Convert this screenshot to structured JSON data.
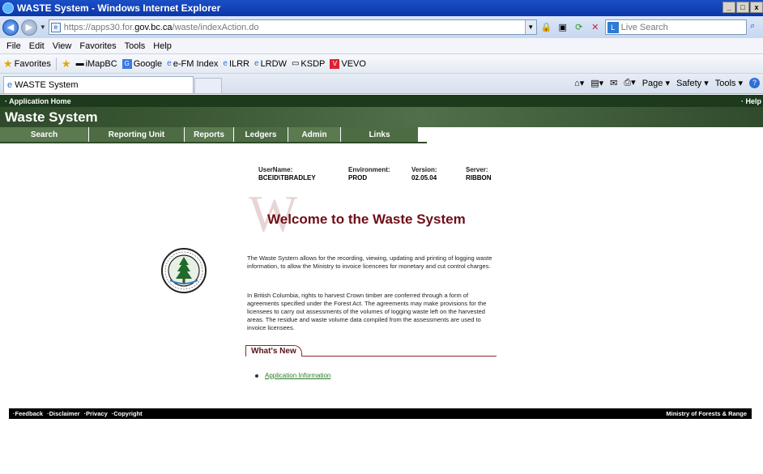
{
  "window": {
    "title": "WASTE System - Windows Internet Explorer",
    "controls": [
      "_",
      "□",
      "x"
    ]
  },
  "address": {
    "url_prefix": "https://apps30.for.",
    "url_domain": "gov.bc.ca",
    "url_path": "/waste/indexAction.do",
    "search_placeholder": "Live Search"
  },
  "menu": [
    "File",
    "Edit",
    "View",
    "Favorites",
    "Tools",
    "Help"
  ],
  "favorites": {
    "label": "Favorites",
    "items": [
      "iMapBC",
      "Google",
      "e-FM Index",
      "ILRR",
      "LRDW",
      "KSDP",
      "VEVO"
    ]
  },
  "tab": {
    "title": "WASTE System"
  },
  "command_bar": [
    "Page",
    "Safety",
    "Tools"
  ],
  "app": {
    "home_link": "· Application Home",
    "help_link": "· Help",
    "title": "Waste System",
    "nav": [
      "Search",
      "Reporting Unit",
      "Reports",
      "Ledgers",
      "Admin",
      "Links"
    ]
  },
  "info": {
    "username_label": "UserName:",
    "username": "BCEID\\TBRADLEY",
    "environment_label": "Environment:",
    "environment": "PROD",
    "version_label": "Version:",
    "version": "02.05.04",
    "server_label": "Server:",
    "server": "RIBBON"
  },
  "welcome": {
    "big_letter": "W",
    "heading": "Welcome to the Waste System",
    "para1": "The Waste System allows for the recording, viewing, updating and printing of logging waste information, to allow the Ministry to invoice licencees for monetary and cut control charges.",
    "para2": "In British Columbia, rights to harvest Crown timber are conferred through a form of agreements specified under the Forest Act. The agreements may make provisions for the licensees to carry out assessments of the volumes of logging waste left on the harvested areas. The residue and waste volume data compiled from the assessments are used to invoice licensees."
  },
  "whats_new": {
    "label": "What's New",
    "items": [
      "Application Information"
    ]
  },
  "footer": {
    "links": [
      "·Feedback",
      "·Disclaimer",
      "·Privacy",
      "·Copyright"
    ],
    "ministry": "Ministry of Forests & Range"
  }
}
